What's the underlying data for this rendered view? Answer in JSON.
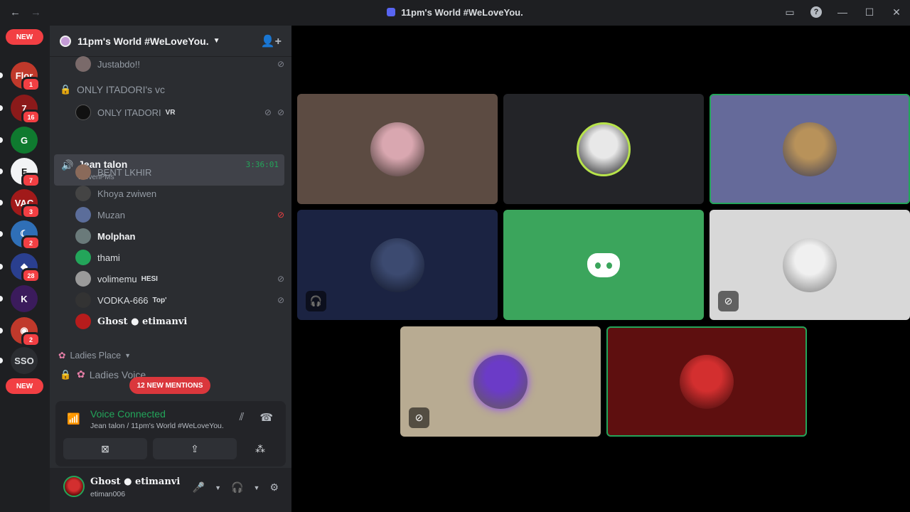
{
  "window": {
    "title": "11pm's World #WeLoveYou.",
    "back": "←",
    "forward": "→"
  },
  "guilds": {
    "new_label": "NEW",
    "items": [
      {
        "label": "Flor",
        "badge": "1",
        "color": "#c0392b"
      },
      {
        "label": "7",
        "badge": "16",
        "color": "#8b1a1a"
      },
      {
        "label": "G",
        "badge": "",
        "color": "#0f7a2f"
      },
      {
        "label": "F",
        "badge": "7",
        "color": "#f2f3f5"
      },
      {
        "label": "VAC",
        "badge": "3",
        "color": "#a11a1a"
      },
      {
        "label": "☾",
        "badge": "2",
        "color": "#2f6fb7"
      },
      {
        "label": "◆",
        "badge": "28",
        "color": "#2a3f8f"
      },
      {
        "label": "K",
        "badge": "",
        "color": "#3b1b5c"
      },
      {
        "label": "◉",
        "badge": "2",
        "color": "#c0392b"
      },
      {
        "label": "SSO",
        "badge": "",
        "color": "#2b2d31"
      }
    ]
  },
  "server": {
    "name": "11pm's World #WeLoveYou."
  },
  "channels": {
    "user_justabdo": "Justabdo!!",
    "locked_category": "ONLY ITADORI's vc",
    "itadori_user": "ONLY ITADORI",
    "itadori_tag": "VR",
    "active_channel": {
      "name": "Jean talon",
      "sub": "ElevenPMs",
      "timer": "3:36:01"
    },
    "members": [
      {
        "name": "BENT LKHIR",
        "tag": "",
        "color": "#8a6a5a"
      },
      {
        "name": "Khoya zwiwen",
        "tag": "",
        "color": "#444"
      },
      {
        "name": "Muzan",
        "tag": "",
        "color": "#5b6d9a"
      },
      {
        "name": "Molphan",
        "tag": "",
        "color": "#6a7a7a"
      },
      {
        "name": "thami",
        "tag": "",
        "color": "#23a55a"
      },
      {
        "name": "volimemu",
        "tag": "HESI",
        "color": "#9a9a9a"
      },
      {
        "name": "VODKA-666",
        "tag": "Top'",
        "color": "#333"
      },
      {
        "name": "Ghost ● etimanvi",
        "tag": "",
        "color": "#b71c1c"
      }
    ],
    "category_ladies": "Ladies Place",
    "ladies_voice": "Ladies Voice",
    "new_label": "NEW",
    "mentions": "12 NEW MENTIONS"
  },
  "voice": {
    "status": "Voice Connected",
    "location": "Jean talon / 11pm's World #WeLoveYou."
  },
  "user": {
    "display_name": "Ghost ● etimanvi",
    "username": "etiman006"
  },
  "tiles": [
    {
      "bg": "#5c4b42",
      "avatar": "#d9a7b0",
      "speaking": false,
      "muted": false,
      "deafened": false
    },
    {
      "bg": "#232428",
      "avatar": "#e8e8e8",
      "speaking": false,
      "muted": false,
      "deafened": false
    },
    {
      "bg": "#656a9a",
      "avatar": "#b8925a",
      "speaking": true,
      "muted": false,
      "deafened": false
    },
    {
      "bg": "#1b2342",
      "avatar": "#3c4a70",
      "speaking": false,
      "muted": false,
      "deafened": true
    },
    {
      "bg": "#3ba55c",
      "avatar": "",
      "speaking": false,
      "muted": false,
      "deafened": false
    },
    {
      "bg": "#d8d8d8",
      "avatar": "#f0f0f0",
      "speaking": false,
      "muted": true,
      "deafened": false
    },
    {
      "bg": "#b8ab92",
      "avatar": "#6b3bc7",
      "speaking": false,
      "muted": true,
      "deafened": false
    },
    {
      "bg": "#5e0f0f",
      "avatar": "#d32f2f",
      "speaking": true,
      "muted": false,
      "deafened": false
    }
  ]
}
